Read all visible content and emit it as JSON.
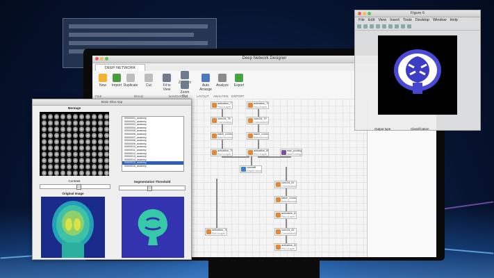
{
  "deep_network_designer": {
    "window_title": "Deep Network Designer",
    "ribbon_tab": "DEEP NETWORK DESIGNER",
    "buttons": [
      {
        "label": "New",
        "color": "#f2b233"
      },
      {
        "label": "Import",
        "color": "#4a9d3e"
      },
      {
        "label": "Duplicate",
        "color": "#bdbdbd"
      },
      {
        "label": "Cut",
        "color": "#bdbdbd"
      },
      {
        "label": "Fit to View",
        "color": "#6d7b8c"
      },
      {
        "label": "Zoom In",
        "color": "#6d7b8c"
      },
      {
        "label": "Zoom Out",
        "color": "#6d7b8c"
      },
      {
        "label": "Auto Arrange",
        "color": "#4f79b8"
      },
      {
        "label": "Analyze",
        "color": "#8b8b8b"
      },
      {
        "label": "Export",
        "color": "#47a23f"
      }
    ],
    "sections": [
      "FILE",
      "BUILD",
      "NAVIGATE",
      "LAYOUT",
      "ANALYSIS",
      "EXPORT"
    ],
    "layers": [
      {
        "name": "activation_77",
        "type": "ReLULayer",
        "color": "#e8843a"
      },
      {
        "name": "activation_78",
        "type": "ReLULayer",
        "color": "#e8843a"
      },
      {
        "name": "conv2d_78",
        "type": "Convolution2D",
        "color": "#e8843a"
      },
      {
        "name": "conv2d_79",
        "type": "Convolution2D",
        "color": "#e8843a"
      },
      {
        "name": "batch_normali...",
        "type": "BatchNormaliz...",
        "color": "#e8843a"
      },
      {
        "name": "batch_normali...",
        "type": "BatchNormaliz...",
        "color": "#e8843a"
      },
      {
        "name": "activation_79",
        "type": "ReLULayer",
        "color": "#e8843a"
      },
      {
        "name": "activation_80",
        "type": "ReLULayer",
        "color": "#e8843a"
      },
      {
        "name": "max_pooling2...",
        "type": "MaxPooling2D",
        "color": "#7b4fa0"
      },
      {
        "name": "concat8",
        "type": "DepthConcat",
        "color": "#3f7fcf"
      },
      {
        "name": "conv2d_81",
        "type": "Convolution2D",
        "color": "#e8843a"
      },
      {
        "name": "batch_normali...",
        "type": "BatchNormaliz...",
        "color": "#e8843a"
      },
      {
        "name": "activation_81",
        "type": "ReLULayer",
        "color": "#e8843a"
      },
      {
        "name": "conv2d_82",
        "type": "Convolution2D",
        "color": "#e8843a"
      },
      {
        "name": "activation_78",
        "type": "ReLULayer",
        "color": "#e8843a"
      },
      {
        "name": "activation_84",
        "type": "ReLULayer",
        "color": "#e8843a"
      }
    ],
    "properties_rows": [
      "Output type",
      "Classification"
    ]
  },
  "brain_app": {
    "window_title": "Brain Slice App",
    "montage_label": "Montage",
    "contrast_label": "Contrast",
    "original_label": "Original Image",
    "threshold_label": "Segmentation Threshold",
    "list_items": [
      "00000001_anatomy",
      "00000002_anatomy",
      "00000003_anatomy",
      "00000004_anatomy",
      "00000005_anatomy",
      "00000006_anatomy",
      "00000007_anatomy",
      "00000008_anatomy",
      "00000009_anatomy",
      "00000010_anatomy",
      "00000011_anatomy",
      "00000012_anatomy",
      "00000013_anatomy",
      "00000014_anatomy",
      "00000015_anatomy",
      "00000016_anatomy"
    ],
    "selected_index": 14,
    "contrast_value": 0.55,
    "threshold_value": 0.45
  },
  "figure6": {
    "window_title": "Figure 6",
    "menu": [
      "File",
      "Edit",
      "View",
      "Insert",
      "Tools",
      "Desktop",
      "Window",
      "Help"
    ]
  }
}
